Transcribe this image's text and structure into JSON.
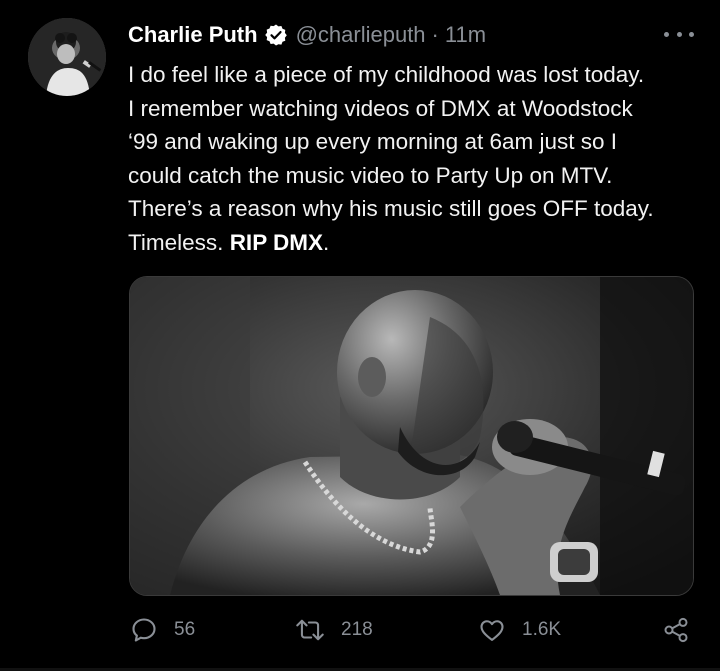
{
  "tweet": {
    "display_name": "Charlie Puth",
    "handle": "@charlieputh",
    "separator": "·",
    "time": "11m",
    "text_lines": [
      "I do feel like a piece of my childhood was lost today.",
      "I remember watching videos of DMX at Woodstock",
      "‘99 and waking up every morning at 6am just so I",
      "could catch the music video to Party Up on MTV.",
      "There’s a reason why his music still goes OFF today."
    ],
    "last_line_prefix": "Timeless. ",
    "last_line_bold": "RIP DMX",
    "last_line_suffix": ".",
    "stats": {
      "replies": "56",
      "retweets": "218",
      "likes": "1.6K"
    }
  },
  "icons": {
    "verified": "verified-badge-icon",
    "more": "more-options-icon",
    "reply": "reply-icon",
    "retweet": "retweet-icon",
    "like": "heart-icon",
    "share": "share-icon"
  },
  "colors": {
    "background": "#000000",
    "text": "#ffffff",
    "muted": "#8a8f96"
  }
}
